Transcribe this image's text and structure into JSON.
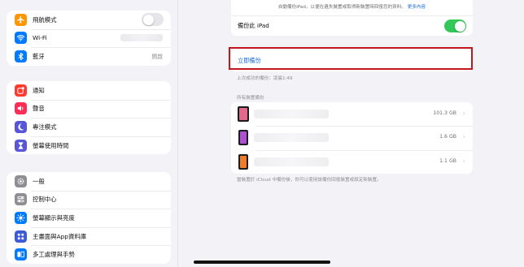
{
  "sidebar": {
    "groups": [
      [
        {
          "label": "飛航模式",
          "icon": "airplane-icon",
          "color": "#ff9500",
          "accessory": "toggle-off"
        },
        {
          "label": "Wi-Fi",
          "icon": "wifi-icon",
          "color": "#007aff",
          "accessory": "hidden-value"
        },
        {
          "label": "藍牙",
          "icon": "bluetooth-icon",
          "color": "#007aff",
          "accessory": "value",
          "value": "開啟"
        }
      ],
      [
        {
          "label": "通知",
          "icon": "notification-icon",
          "color": "#ff3b30"
        },
        {
          "label": "聲音",
          "icon": "speaker-icon",
          "color": "#ff2d55"
        },
        {
          "label": "專注模式",
          "icon": "moon-icon",
          "color": "#5856d6"
        },
        {
          "label": "螢幕使用時間",
          "icon": "hourglass-icon",
          "color": "#5856d6"
        }
      ],
      [
        {
          "label": "一般",
          "icon": "gear-icon",
          "color": "#8e8e93"
        },
        {
          "label": "控制中心",
          "icon": "sliders-icon",
          "color": "#8e8e93"
        },
        {
          "label": "螢幕顯示與亮度",
          "icon": "sun-icon",
          "color": "#007aff"
        },
        {
          "label": "主畫面與App資料庫",
          "icon": "grid-icon",
          "color": "#3c5bd6"
        },
        {
          "label": "多工處理與手勢",
          "icon": "multitask-icon",
          "color": "#007aff"
        }
      ]
    ]
  },
  "backup": {
    "description": "自動備份iPad，以便在遺失裝置或取得新裝置時回復您的資料。",
    "more_link": "更多內容",
    "icloud_backup_label": "備份此 iPad",
    "icloud_backup_enabled": true,
    "backup_now_label": "立即備份",
    "last_backup": "上次成功的備份：凌晨1:49",
    "devices_header": "所有裝置備份",
    "devices": [
      {
        "size": "101.3 GB",
        "icon": "ipad-icon",
        "screen": "#e06a8a"
      },
      {
        "size": "1.6 GB",
        "icon": "iphone-icon",
        "screen": "#b04fd1"
      },
      {
        "size": "1.1 GB",
        "icon": "iphone-icon",
        "screen": "#f07c2a"
      }
    ],
    "footer_note": "當裝置於 iCloud 中備份後，你可以使用該備份回復裝置或設定新裝置。"
  }
}
